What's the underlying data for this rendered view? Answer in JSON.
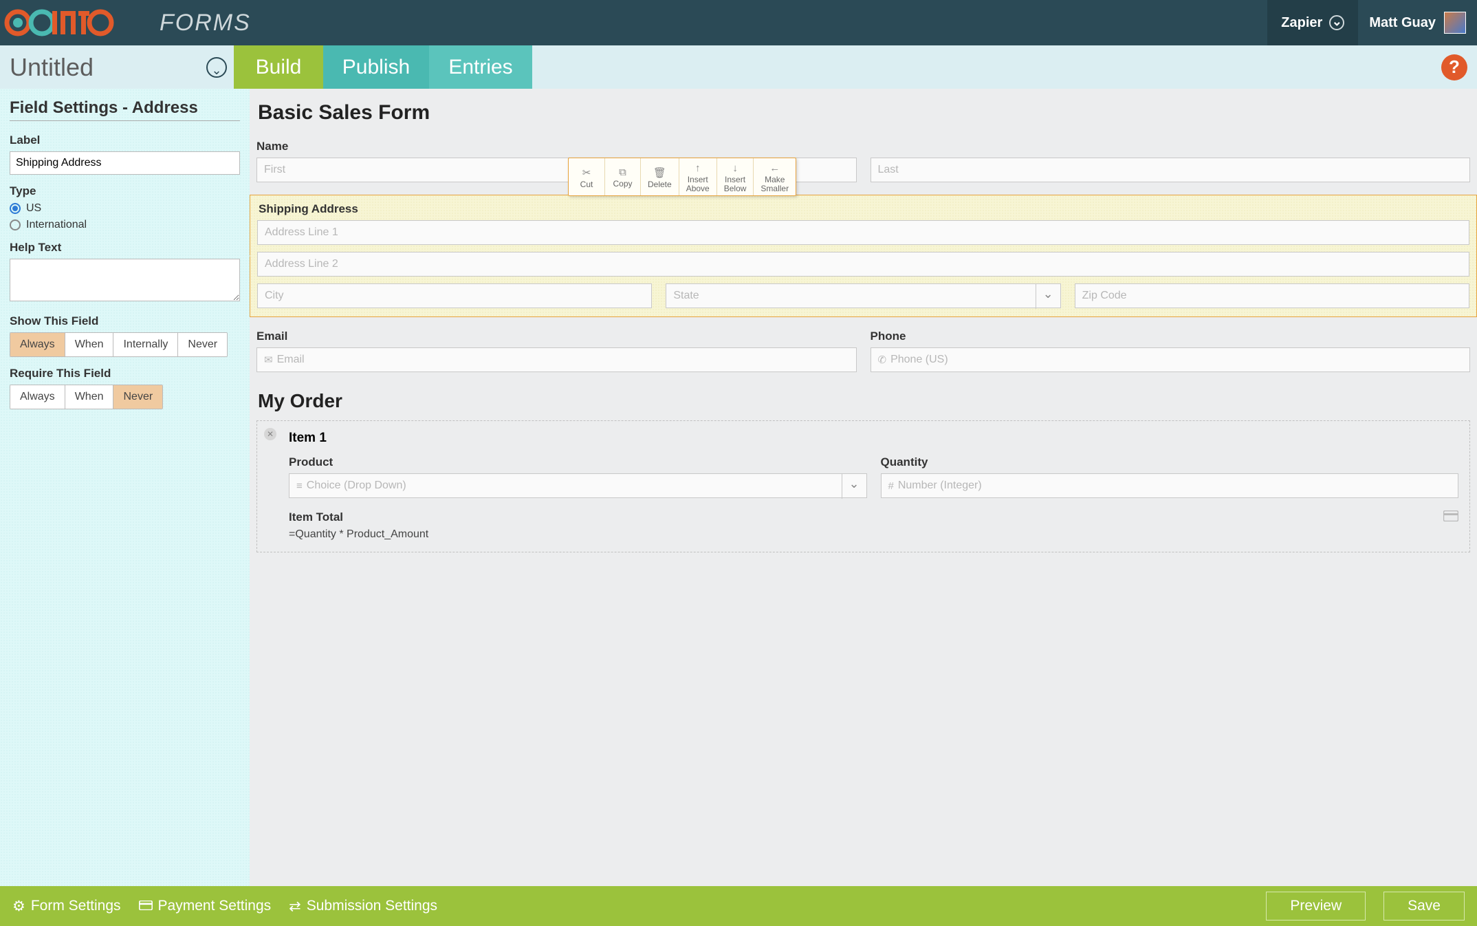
{
  "brand": {
    "forms_word": "FORMS"
  },
  "topbar": {
    "org_name": "Zapier",
    "user_name": "Matt Guay"
  },
  "subheader": {
    "title": "Untitled",
    "tabs": {
      "build": "Build",
      "publish": "Publish",
      "entries": "Entries"
    },
    "help": "?"
  },
  "sidebar": {
    "panel_title": "Field Settings - Address",
    "label_heading": "Label",
    "label_value": "Shipping Address",
    "type_heading": "Type",
    "type_options": {
      "us": "US",
      "intl": "International"
    },
    "help_heading": "Help Text",
    "help_value": "",
    "show_heading": "Show This Field",
    "show_options": {
      "always": "Always",
      "when": "When",
      "internally": "Internally",
      "never": "Never"
    },
    "require_heading": "Require This Field",
    "require_options": {
      "always": "Always",
      "when": "When",
      "never": "Never"
    }
  },
  "context_toolbar": {
    "cut": "Cut",
    "copy": "Copy",
    "delete": "Delete",
    "insert_above_1": "Insert",
    "insert_above_2": "Above",
    "insert_below_1": "Insert",
    "insert_below_2": "Below",
    "make_smaller_1": "Make",
    "make_smaller_2": "Smaller"
  },
  "canvas": {
    "form_heading": "Basic Sales Form",
    "name": {
      "label": "Name",
      "first_ph": "First",
      "last_ph": "Last"
    },
    "address": {
      "label": "Shipping Address",
      "line1_ph": "Address Line 1",
      "line2_ph": "Address Line 2",
      "city_ph": "City",
      "state_ph": "State",
      "zip_ph": "Zip Code"
    },
    "email": {
      "label": "Email",
      "ph": "Email"
    },
    "phone": {
      "label": "Phone",
      "ph": "Phone (US)"
    },
    "order": {
      "heading": "My Order",
      "item_title": "Item 1",
      "product_label": "Product",
      "product_ph": "Choice (Drop Down)",
      "quantity_label": "Quantity",
      "quantity_ph": "Number (Integer)",
      "item_total_label": "Item Total",
      "item_total_formula": "=Quantity * Product_Amount"
    }
  },
  "bottombar": {
    "form_settings": "Form Settings",
    "payment_settings": "Payment Settings",
    "submission_settings": "Submission Settings",
    "preview": "Preview",
    "save": "Save"
  }
}
